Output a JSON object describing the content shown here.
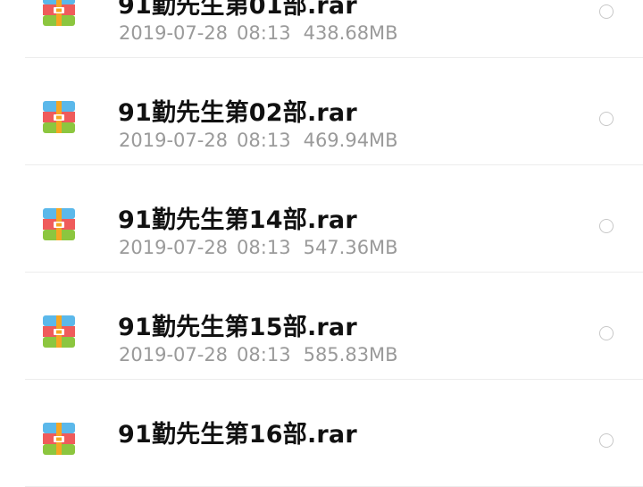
{
  "files": [
    {
      "name": "91勤先生第01部.rar",
      "date": "2019-07-28",
      "time": "08:13",
      "size": "438.68MB",
      "icon": "archive-icon",
      "selected": false
    },
    {
      "name": "91勤先生第02部.rar",
      "date": "2019-07-28",
      "time": "08:13",
      "size": "469.94MB",
      "icon": "archive-icon",
      "selected": false
    },
    {
      "name": "91勤先生第14部.rar",
      "date": "2019-07-28",
      "time": "08:13",
      "size": "547.36MB",
      "icon": "archive-icon",
      "selected": false
    },
    {
      "name": "91勤先生第15部.rar",
      "date": "2019-07-28",
      "time": "08:13",
      "size": "585.83MB",
      "icon": "archive-icon",
      "selected": false
    },
    {
      "name": "91勤先生第16部.rar",
      "date": "",
      "time": "",
      "size": "",
      "icon": "archive-icon",
      "selected": false
    }
  ],
  "colors": {
    "archive_top": "#5bb8ea",
    "archive_middle": "#ef5b5b",
    "archive_bottom": "#8cc63f",
    "archive_strap": "#f5a623",
    "meta_text": "#9a9a9a",
    "radio_border": "#c8c8c8"
  }
}
